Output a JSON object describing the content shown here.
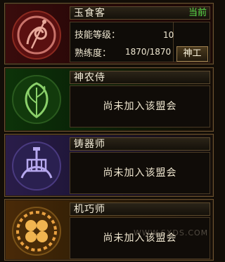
{
  "professions": [
    {
      "name": "玉食客",
      "status": "当前",
      "skill_level_label": "技能等级：",
      "skill_level_value": "10",
      "proficiency_label": "熟练度：",
      "proficiency_value": "1870/1870",
      "action_label": "神工",
      "emblem_icon": "chef-dragon-icon",
      "color": "#3a0c0c"
    },
    {
      "name": "神农侍",
      "message": "尚未加入该盟会",
      "emblem_icon": "herb-leaf-icon",
      "color": "#0d3309"
    },
    {
      "name": "铸器师",
      "message": "尚未加入该盟会",
      "emblem_icon": "forge-anvil-icon",
      "color": "#2a1d4a"
    },
    {
      "name": "机巧师",
      "message": "尚未加入该盟会",
      "emblem_icon": "gear-clover-icon",
      "color": "#4a2a08"
    }
  ],
  "watermark": {
    "url": "WWW.SXDS.COM"
  }
}
